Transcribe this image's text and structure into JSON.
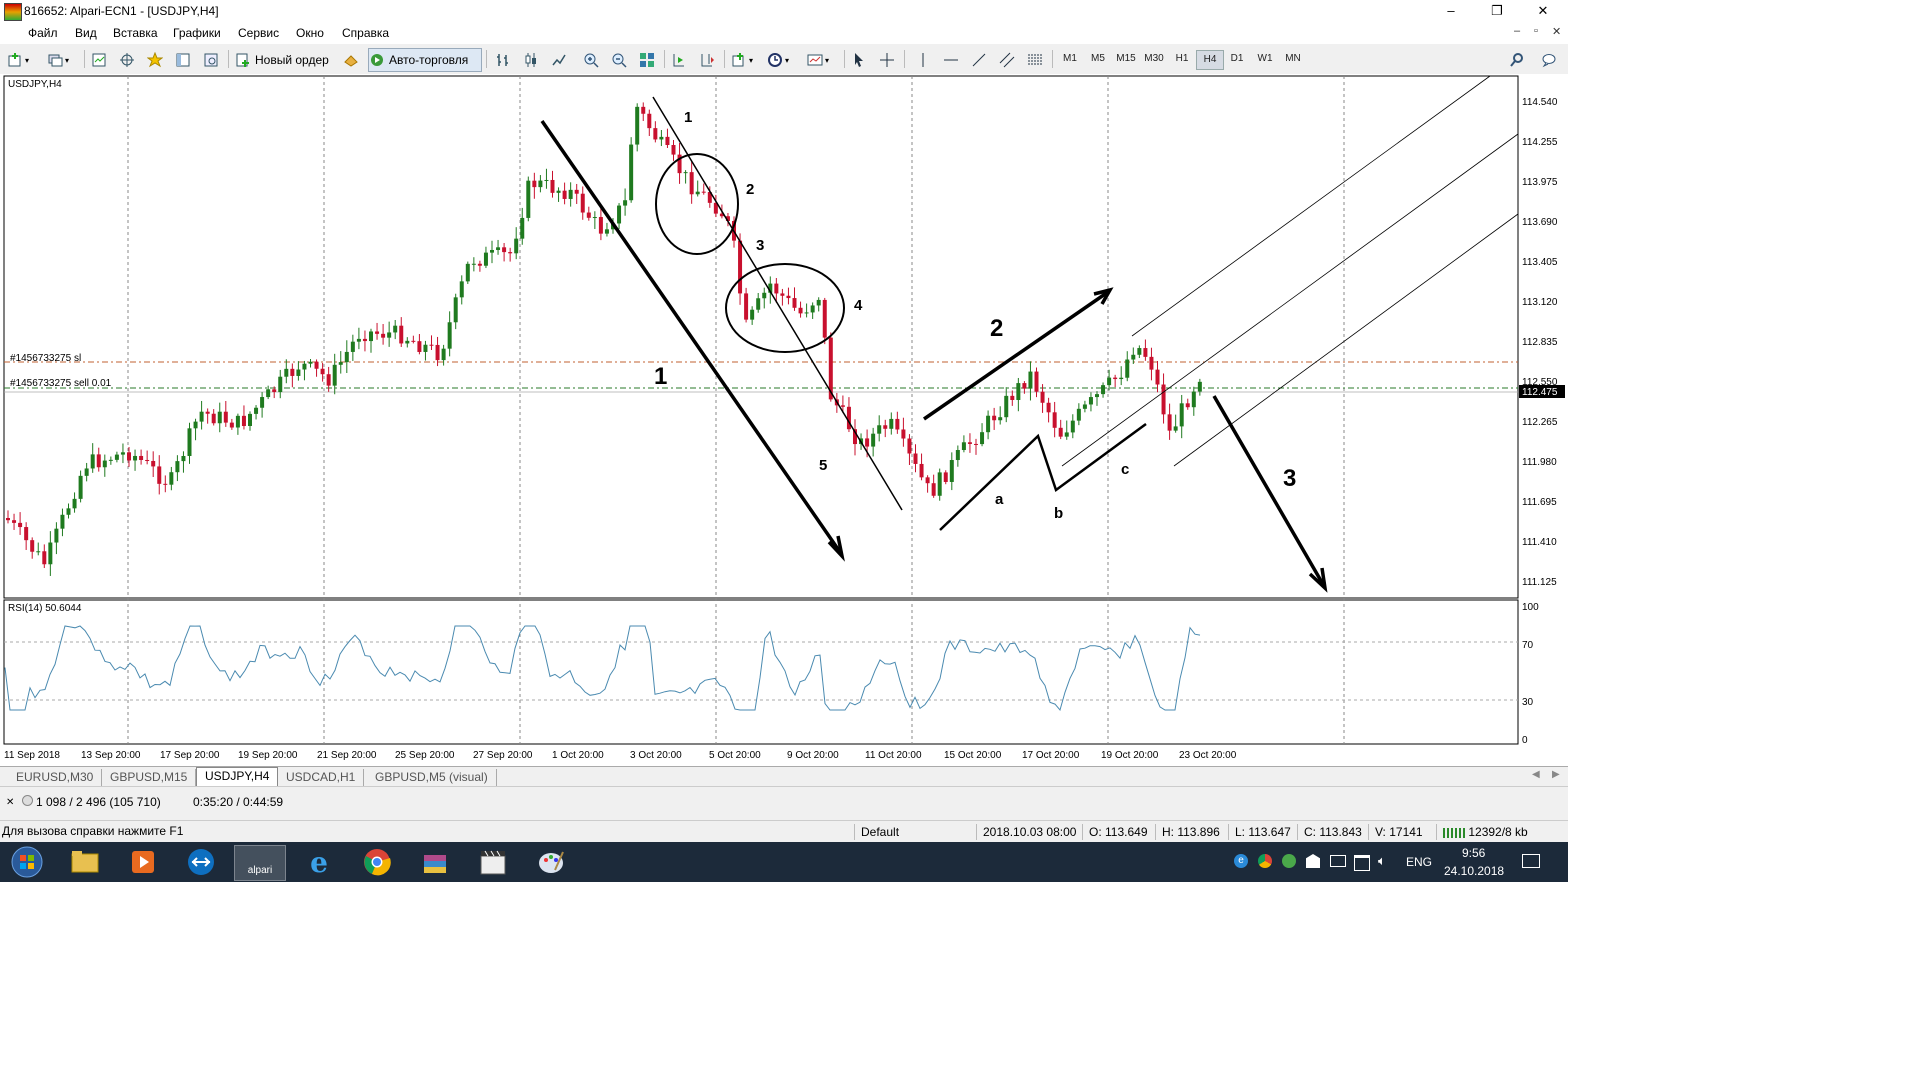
{
  "window": {
    "title": "816652: Alpari-ECN1 - [USDJPY,H4]",
    "minimize": "–",
    "maximize": "❐",
    "close": "✕"
  },
  "menu": {
    "items": [
      "Файл",
      "Вид",
      "Вставка",
      "Графики",
      "Сервис",
      "Окно",
      "Справка"
    ],
    "mdi": [
      "–",
      "▫",
      "✕"
    ]
  },
  "toolbar": {
    "new_order": "Новый ордер",
    "auto_trading": "Авто-торговля",
    "timeframes": [
      "M1",
      "M5",
      "M15",
      "M30",
      "H1",
      "H4",
      "D1",
      "W1",
      "MN"
    ],
    "active_timeframe": "H4"
  },
  "chart": {
    "symbol_label": "USDJPY,H4",
    "price_labels": [
      "114.540",
      "114.255",
      "113.975",
      "113.690",
      "113.405",
      "113.120",
      "112.835",
      "112.550",
      "112.265",
      "111.980",
      "111.695",
      "111.410",
      "111.125"
    ],
    "current_price": "112.475",
    "sl_label": "#1456733275 sl",
    "order_label": "#1456733275 sell 0.01",
    "rsi_label": "RSI(14) 50.6044",
    "rsi_levels": [
      "100",
      "70",
      "30",
      "0"
    ],
    "dates": [
      "11 Sep 2018",
      "13 Sep 20:00",
      "17 Sep 20:00",
      "19 Sep 20:00",
      "21 Sep 20:00",
      "25 Sep 20:00",
      "27 Sep 20:00",
      "1 Oct 20:00",
      "3 Oct 20:00",
      "5 Oct 20:00",
      "9 Oct 20:00",
      "11 Oct 20:00",
      "15 Oct 20:00",
      "17 Oct 20:00",
      "19 Oct 20:00",
      "23 Oct 20:00"
    ],
    "annotations": [
      "1",
      "2",
      "3",
      "4",
      "5",
      "1",
      "2",
      "3",
      "a",
      "b",
      "c"
    ],
    "colors": {
      "bull": "#1f7a1f",
      "bear": "#c8102e",
      "rsi": "#4a8ab0",
      "sl_line": "#c06030",
      "order_line": "#2a7a2a"
    }
  },
  "tabs": {
    "items": [
      "EURUSD,M30",
      "GBPUSD,M15",
      "USDJPY,H4",
      "USDCAD,H1",
      "GBPUSD,M5 (visual)"
    ],
    "active": "USDJPY,H4"
  },
  "statusline": {
    "stats": "1 098 / 2 496 (105 710)",
    "timer": "0:35:20 / 0:44:59"
  },
  "statusbar": {
    "help": "Для вызова справки нажмите F1",
    "profile": "Default",
    "datetime": "2018.10.03 08:00",
    "open": "O: 113.649",
    "high": "H: 113.896",
    "low": "L: 113.647",
    "close": "C: 113.843",
    "volume": "V: 17141",
    "traffic": "12392/8 kb"
  },
  "taskbar": {
    "alpari_label": "alpari",
    "lang": "ENG",
    "time": "9:56",
    "date": "24.10.2018"
  }
}
